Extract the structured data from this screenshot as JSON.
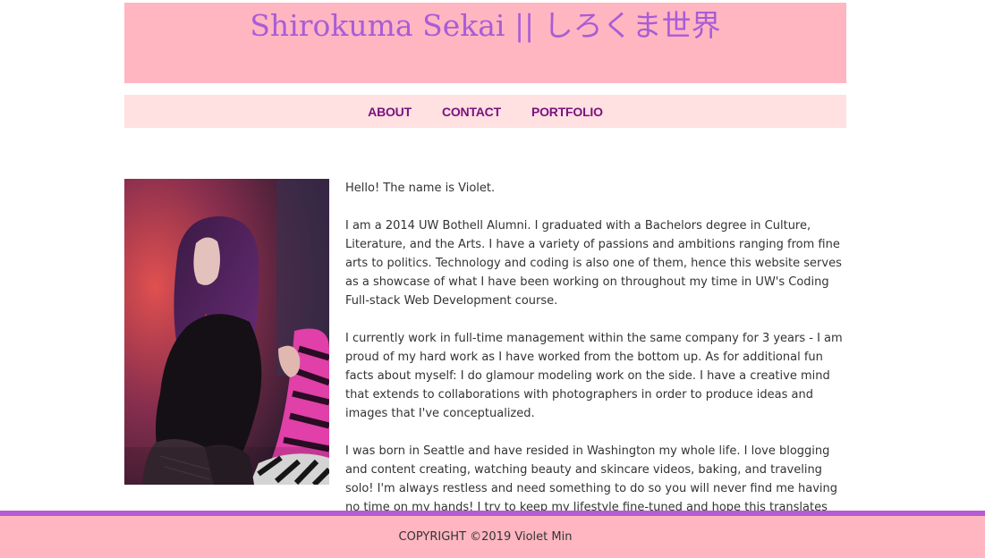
{
  "header": {
    "title": "Shirokuma Sekai || しろくま世界"
  },
  "nav": {
    "items": [
      {
        "label": "ABOUT"
      },
      {
        "label": "CONTACT"
      },
      {
        "label": "PORTFOLIO"
      }
    ]
  },
  "about": {
    "paragraphs": [
      "Hello! The name is Violet.",
      "I am a 2014 UW Bothell Alumni. I graduated with a Bachelors degree in Culture, Literature, and the Arts. I have a variety of passions and ambitions ranging from fine arts to politics. Technology and coding is also one of them, hence this website serves as a showcase of what I have been working on throughout my time in UW's Coding Full-stack Web Development course.",
      "I currently work in full-time management within the same company for 3 years - I am proud of my hard work as I have worked from the bottom up. As for additional fun facts about myself: I do glamour modeling work on the side. I have a creative mind that extends to collaborations with photographers in order to produce ideas and images that I've conceptualized.",
      "I was born in Seattle and have resided in Washington my whole life. I love blogging and content creating, watching beauty and skincare videos, baking, and traveling solo! I'm always restless and need something to do so you will never find me having no time on my hands! I try to keep my lifestyle fine-tuned and hope this translates into my coding."
    ]
  },
  "footer": {
    "copyright": "COPYRIGHT ©2019 Violet Min"
  },
  "colors": {
    "banner": "#ffb6c1",
    "title": "#a95cd8",
    "nav_bg": "#ffe1e1",
    "nav_link": "#7a1280",
    "footer_border": "#b45cd6"
  }
}
